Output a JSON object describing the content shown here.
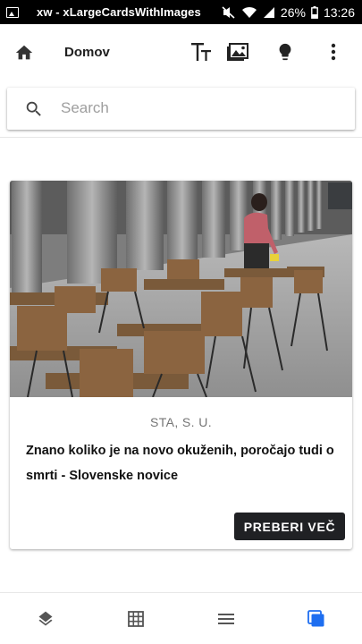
{
  "status_bar": {
    "title": "xw - xLargeCardsWithImages",
    "battery": "26%",
    "time": "13:26"
  },
  "app_bar": {
    "home_icon": "home-icon",
    "title": "Domov",
    "actions": [
      "text-size-icon",
      "image-icon",
      "lightbulb-icon",
      "more-vert-icon"
    ]
  },
  "search": {
    "placeholder": "Search",
    "value": ""
  },
  "card": {
    "image": "photo of a woman cleaning outdoor cafe tables and chairs under a colonnade",
    "source": "STA, S. U.",
    "headline": "Znano koliko je na novo okuženih, poročajo tudi o smrti - Slovenske novice",
    "button_label": "PREBERI VEČ"
  },
  "bottom_nav": {
    "items": [
      "layers-icon",
      "grid-icon",
      "list-icon",
      "cards-icon"
    ],
    "active_index": 3,
    "active_color": "#1e6ef0",
    "inactive_color": "#555555"
  }
}
